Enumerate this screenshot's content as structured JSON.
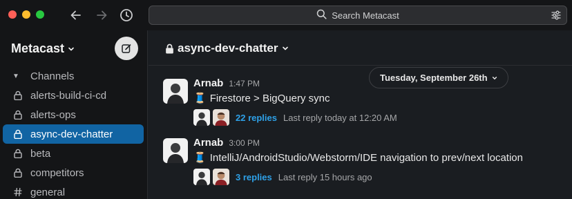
{
  "toolbar": {
    "search_placeholder": "Search Metacast"
  },
  "sidebar": {
    "workspace": "Metacast",
    "section_label": "Channels",
    "channels": [
      {
        "label": "alerts-build-ci-cd",
        "icon": "lock-icon",
        "active": false
      },
      {
        "label": "alerts-ops",
        "icon": "lock-icon",
        "active": false
      },
      {
        "label": "async-dev-chatter",
        "icon": "lock-icon",
        "active": true
      },
      {
        "label": "beta",
        "icon": "lock-icon",
        "active": false
      },
      {
        "label": "competitors",
        "icon": "lock-icon",
        "active": false
      },
      {
        "label": "general",
        "icon": "hash-icon",
        "active": false
      }
    ]
  },
  "channel": {
    "name": "async-dev-chatter",
    "date_divider": "Tuesday, September 26th"
  },
  "messages": [
    {
      "author": "Arnab",
      "time": "1:47 PM",
      "emoji": "🧵",
      "text": "Firestore > BigQuery sync",
      "replies": "22 replies",
      "last_reply": "Last reply today at 12:20 AM"
    },
    {
      "author": "Arnab",
      "time": "3:00 PM",
      "emoji": "🧵",
      "text": "IntelliJ/AndroidStudio/Webstorm/IDE navigation to prev/next location",
      "replies": "3 replies",
      "last_reply": "Last reply 15 hours ago"
    }
  ],
  "colors": {
    "active_channel": "#1164a3",
    "link": "#2ea1e8",
    "window_close": "#ff5f57",
    "window_minimize": "#febc2e",
    "window_zoom": "#28c840"
  }
}
